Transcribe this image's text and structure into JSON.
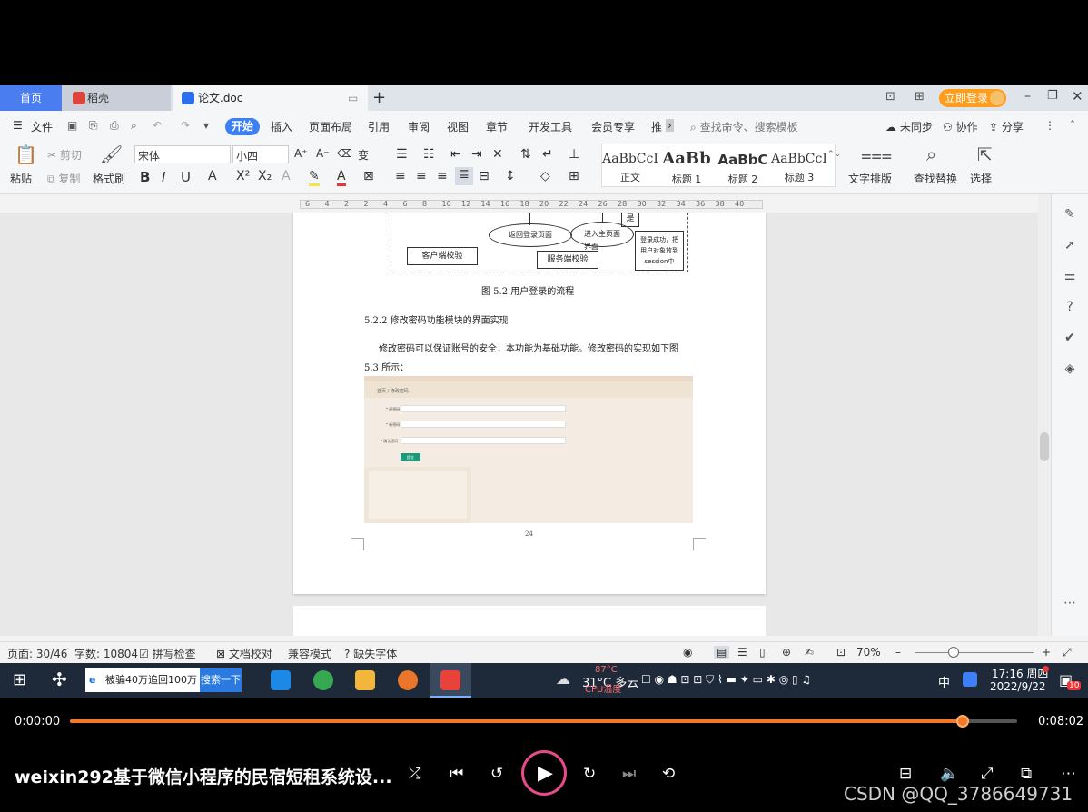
{
  "tabs": {
    "home": "首页",
    "daoke": "稻壳",
    "doc": "论文.doc",
    "login": "立即登录"
  },
  "menu": {
    "file": "文件",
    "items": [
      "开始",
      "插入",
      "页面布局",
      "引用",
      "审阅",
      "视图",
      "章节",
      "开发工具",
      "会员专享",
      "推"
    ],
    "search_placeholder": "查找命令、搜索模板",
    "sync": "未同步",
    "collab": "协作",
    "share": "分享"
  },
  "ribbon": {
    "paste": "粘贴",
    "cut": "剪切",
    "copy": "复制",
    "format_painter": "格式刷",
    "font_name": "宋体",
    "font_size": "小四",
    "styles": [
      {
        "preview": "AaBbCcI",
        "name": "正文"
      },
      {
        "preview": "AaBb",
        "name": "标题 1"
      },
      {
        "preview": "AaBbC",
        "name": "标题 2"
      },
      {
        "preview": "AaBbCcI",
        "name": "标题 3"
      }
    ],
    "text_layout": "文字排版",
    "find_replace": "查找替换",
    "select": "选择"
  },
  "ruler_ticks": [
    "6",
    "4",
    "2",
    "2",
    "4",
    "6",
    "8",
    "10",
    "12",
    "14",
    "16",
    "18",
    "20",
    "22",
    "24",
    "26",
    "28",
    "30",
    "32",
    "34",
    "36",
    "38",
    "40"
  ],
  "document": {
    "flow": {
      "yes": "是",
      "return_login": "返回登录页面",
      "enter_main": "进入主页面",
      "main_overlap": "界面",
      "login_success": "登录成功，把用户对象放到session中",
      "client_check": "客户端校验",
      "server_check": "服务端校验"
    },
    "figure_caption": "图 5.2 用户登录的流程",
    "section_title": "5.2.2 修改密码功能模块的界面实现",
    "para_line1": "修改密码可以保证账号的安全，本功能为基础功能。修改密码的实现如下图",
    "para_line2": "5.3 所示：",
    "screenshot": {
      "breadcrumb_home": "首页",
      "breadcrumb_page": "修改密码",
      "field1": "* 原密码",
      "field2": "* 新密码",
      "field3": "* 确认密码",
      "button": "提交"
    },
    "page_number": "24"
  },
  "status": {
    "page": "页面: 30/46",
    "words": "字数: 10804",
    "spell": "拼写检查",
    "proof": "文档校对",
    "compat": "兼容模式",
    "missing_font": "缺失字体",
    "zoom": "70%"
  },
  "taskbar": {
    "search_text": "被骗40万追回100万",
    "search_btn": "搜索一下",
    "weather": "31°C 多云",
    "cpu_temp": "87°C",
    "cpu_label": "CPU温度",
    "ime": "中",
    "time": "17:16 周四",
    "date": "2022/9/22",
    "notif_count": "10"
  },
  "player": {
    "current_time": "0:00:00",
    "duration": "0:08:02",
    "progress": 0.942,
    "title": "weixin292基于微信小程序的民宿短租系统设...",
    "watermark": "CSDN @QQ_3786649731"
  },
  "colors": {
    "accent_blue": "#3d7ff6",
    "progress_orange": "#f07a26",
    "play_ring": "#e84b8a",
    "login_orange": "#ff9d1f"
  }
}
